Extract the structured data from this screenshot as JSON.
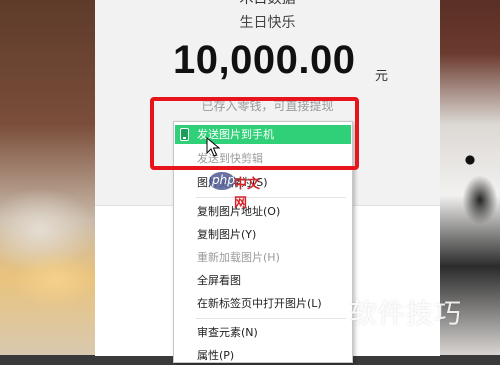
{
  "red_packet": {
    "sender_name": "木目数据",
    "greeting": "生日快乐",
    "amount": "10,000.00",
    "currency": "元",
    "note": "已存入零钱，可直接提现"
  },
  "context_menu": {
    "items": [
      {
        "label": "发送图片到手机",
        "state": "active"
      },
      {
        "label": "发送到快剪辑",
        "state": "disabled"
      },
      {
        "label": "图片另存为(S)",
        "state": "normal"
      },
      {
        "label": "复制图片地址(O)",
        "state": "normal"
      },
      {
        "label": "复制图片(Y)",
        "state": "normal"
      },
      {
        "label": "重新加载图片(H)",
        "state": "disabled"
      },
      {
        "label": "全屏看图",
        "state": "normal"
      },
      {
        "label": "在新标签页中打开图片(L)",
        "state": "normal"
      },
      {
        "label": "审查元素(N)",
        "state": "normal"
      },
      {
        "label": "属性(P)",
        "state": "normal"
      }
    ],
    "accent_color": "#2fd077"
  },
  "annotation": {
    "highlight_color": "#e8141b"
  },
  "watermarks": {
    "php_logo": "php",
    "php_site": "中文网",
    "tips": "软件技巧"
  }
}
